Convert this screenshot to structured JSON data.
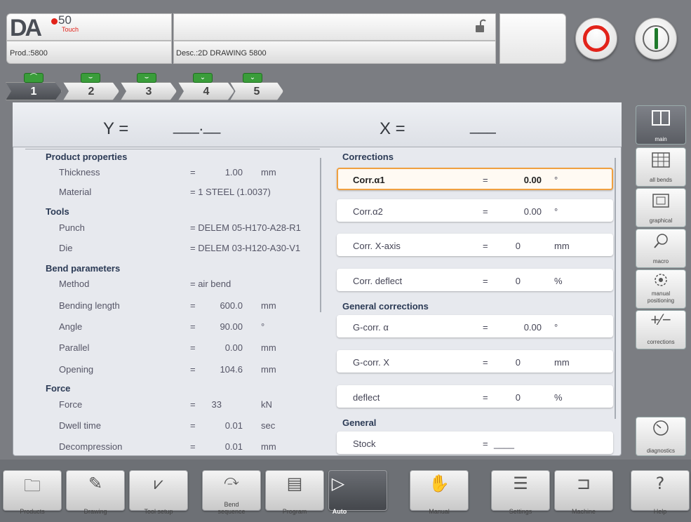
{
  "header": {
    "logo_text": "DA",
    "logo_number": "50",
    "logo_sub": "Touch",
    "prod": "Prod.:5800",
    "desc": "Desc.:2D DRAWING 5800"
  },
  "bend_tabs": [
    "1",
    "2",
    "3",
    "4",
    "5"
  ],
  "axes": {
    "y_label": "Y =",
    "y_value": "___.__",
    "x_label": "X =",
    "x_value": "___"
  },
  "product": {
    "section_product": "Product properties",
    "thickness_label": "Thickness",
    "thickness_eq": "=",
    "thickness_val": "1.00",
    "thickness_unit": "mm",
    "material_label": "Material",
    "material_val": "= 1 STEEL (1.0037)",
    "section_tools": "Tools",
    "punch_label": "Punch",
    "punch_val": "= DELEM 05-H170-A28-R1",
    "die_label": "Die",
    "die_val": "= DELEM 03-H120-A30-V1",
    "section_bend": "Bend parameters",
    "method_label": "Method",
    "method_val": "= air bend",
    "bendlen_label": "Bending length",
    "bendlen_eq": "=",
    "bendlen_val": "600.0",
    "bendlen_unit": "mm",
    "angle_label": "Angle",
    "angle_eq": "=",
    "angle_val": "90.00",
    "angle_unit": "°",
    "parallel_label": "Parallel",
    "parallel_eq": "=",
    "parallel_val": "0.00",
    "parallel_unit": "mm",
    "opening_label": "Opening",
    "opening_eq": "=",
    "opening_val": "104.6",
    "opening_unit": "mm",
    "section_force": "Force",
    "force_label": "Force",
    "force_eq": "=",
    "force_val": "33",
    "force_unit": "kN",
    "dwell_label": "Dwell time",
    "dwell_eq": "=",
    "dwell_val": "0.01",
    "dwell_unit": "sec",
    "decomp_label": "Decompression",
    "decomp_eq": "=",
    "decomp_val": "0.01",
    "decomp_unit": "mm"
  },
  "corrections": {
    "section_corrections": "Corrections",
    "rows": [
      {
        "label": "Corr.α1",
        "eq": "=",
        "val": "0.00",
        "unit": "°"
      },
      {
        "label": "Corr.α2",
        "eq": "=",
        "val": "0.00",
        "unit": "°"
      },
      {
        "label": "Corr. X-axis",
        "eq": "=",
        "val": "0",
        "unit": "mm"
      },
      {
        "label": "Corr. deflect",
        "eq": "=",
        "val": "0",
        "unit": "%"
      }
    ],
    "section_general_corrections": "General corrections",
    "grows": [
      {
        "label": "G-corr. α",
        "eq": "=",
        "val": "0.00",
        "unit": "°"
      },
      {
        "label": "G-corr. X",
        "eq": "=",
        "val": "0",
        "unit": "mm"
      },
      {
        "label": "deflect",
        "eq": "=",
        "val": "0",
        "unit": "%"
      }
    ],
    "section_general": "General",
    "stock_label": "Stock",
    "stock_eq": "=",
    "stock_val": "____"
  },
  "sidebar": {
    "main": "main",
    "all_bends": "all bends",
    "graphical": "graphical",
    "macro": "macro",
    "manual_positioning_1": "manual",
    "manual_positioning_2": "positioning",
    "corrections": "corrections",
    "diagnostics": "diagnostics"
  },
  "nav": {
    "products": "Products",
    "drawing": "Drawing",
    "tool_setup": "Tool setup",
    "bend_sequence_1": "Bend",
    "bend_sequence_2": "sequence",
    "program": "Program",
    "auto": "Auto",
    "manual": "Manual",
    "settings": "Settings",
    "machine": "Machine",
    "help": "Help"
  },
  "icons": {
    "lock": "unlocked-padlock-icon",
    "stop": "stop-icon",
    "start": "start-icon"
  }
}
